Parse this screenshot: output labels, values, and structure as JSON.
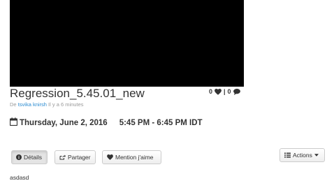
{
  "event": {
    "title": "Regression_5.45.01_new",
    "likes_count": "0",
    "stats_separator": "|",
    "comments_count": "0",
    "byline_prefix": "De",
    "author": "tsvika knirsh",
    "time_ago": "Il y a 6 minutes",
    "date": "Thursday, June 2, 2016",
    "time_range": "5:45 PM - 6:45 PM IDT",
    "description": "asdasd"
  },
  "buttons": {
    "details": "Détails",
    "share": "Partager",
    "like": "Mention j'aime",
    "actions": "Actions"
  },
  "icons": {
    "likes": "heart-icon",
    "comments": "comment-icon",
    "date": "calendar-icon",
    "details": "info-circle-icon",
    "share": "share-icon",
    "like": "heart-icon",
    "actions": "list-icon",
    "actions_caret": "caret-down-icon"
  },
  "colors": {
    "link": "#2a8bd1",
    "muted": "#999999",
    "video_bg": "#000000"
  }
}
